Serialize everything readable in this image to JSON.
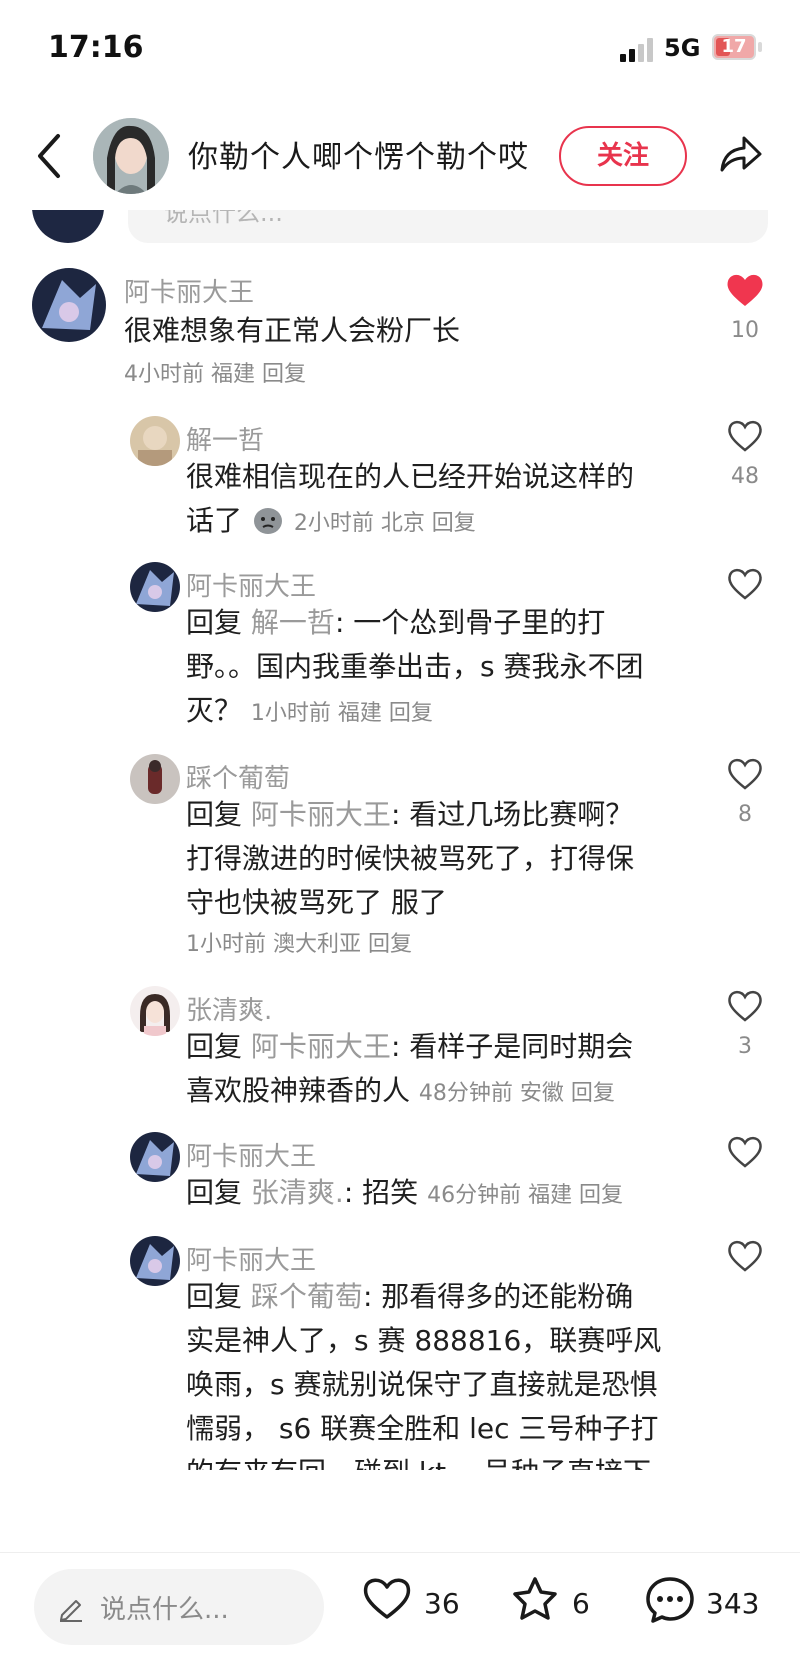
{
  "status_bar": {
    "time": "17:16",
    "network": "5G",
    "battery": "17"
  },
  "header": {
    "title": "你勒个人唧个愣个勒个哎",
    "follow_label": "关注"
  },
  "partial_input": {
    "placeholder": "说点什么..."
  },
  "comments": [
    {
      "name": "阿卡丽大王",
      "text": "很难想象有正常人会粉厂长",
      "meta": "4小时前 福建 回复",
      "likes": "10",
      "liked": true
    },
    {
      "name": "解一哲",
      "text_line1": "很难相信现在的人已经开始说这样的",
      "text_line2": "话了",
      "meta": "2小时前 北京 回复",
      "likes": "48"
    },
    {
      "name": "阿卡丽大王",
      "reply_prefix": "回复",
      "reply_to": "解一哲",
      "text_line1": ": 一个怂到骨子里的打",
      "text_line2": "野。。国内我重拳出击，s 赛我永不团",
      "text_line3": "灭？",
      "meta": "1小时前 福建 回复",
      "likes": ""
    },
    {
      "name": "踩个葡萄",
      "reply_prefix": "回复",
      "reply_to": "阿卡丽大王",
      "text_line1": ": 看过几场比赛啊？",
      "text_line2": "打得激进的时候快被骂死了，打得保",
      "text_line3": "守也快被骂死了 服了",
      "meta": "1小时前 澳大利亚 回复",
      "likes": "8"
    },
    {
      "name": "张清爽.",
      "reply_prefix": "回复",
      "reply_to": "阿卡丽大王",
      "text_line1": ": 看样子是同时期会",
      "text_line2": "喜欢股神辣香的人",
      "meta": "48分钟前 安徽 回复",
      "likes": "3"
    },
    {
      "name": "阿卡丽大王",
      "reply_prefix": "回复",
      "reply_to": "张清爽.",
      "text_line1": ": 招笑",
      "meta": "46分钟前 福建 回复",
      "likes": ""
    },
    {
      "name": "阿卡丽大王",
      "reply_prefix": "回复",
      "reply_to": "踩个葡萄",
      "text_line1": ": 那看得多的还能粉确",
      "text_line2": "实是神人了，s 赛 888816，联赛呼风",
      "text_line3": "唤雨，s 赛就别说保守了直接就是恐惧",
      "text_line4": "懦弱， s6 联赛全胜和 lec 三号种子打",
      "text_line5": "的有来有回，碰到 kt 一号种子直接下",
      "likes": ""
    }
  ],
  "bottom_bar": {
    "placeholder": "说点什么...",
    "likes": "36",
    "stars": "6",
    "comments": "343"
  },
  "colors": {
    "accent": "#e8344d",
    "muted": "#9a9a9a"
  }
}
